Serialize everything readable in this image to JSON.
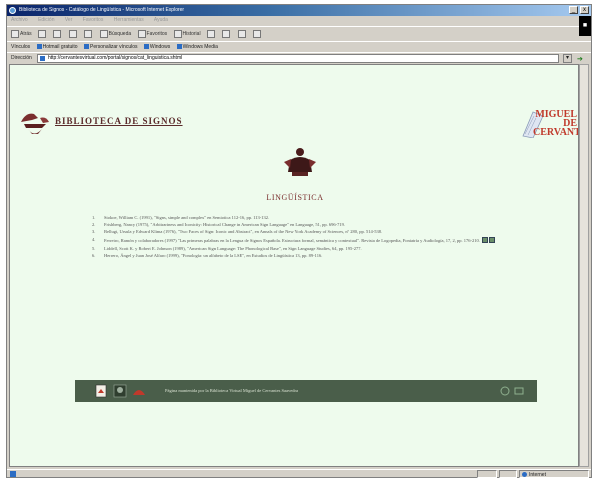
{
  "window": {
    "title": "Biblioteca de Signos - Catálogo de Lingüística - Microsoft Internet Explorer",
    "controls": [
      "_",
      "x"
    ]
  },
  "menu": [
    "Archivo",
    "Edición",
    "Ver",
    "Favoritos",
    "Herramientas",
    "Ayuda"
  ],
  "toolbar": {
    "back": "Atrás",
    "search": "Búsqueda",
    "favorites": "Favoritos",
    "history": "Historial"
  },
  "links": {
    "label": "Vínculos",
    "items": [
      "Hotmail gratuito",
      "Personalizar vínculos",
      "Windows",
      "Windows Media"
    ]
  },
  "address": {
    "label": "Dirección",
    "url": "http://cervantesvirtual.com/portal/signos/cat_linguistica.shtml"
  },
  "page": {
    "site_title": "BIBLIOTECA  DE  SIGNOS",
    "right_logo_text": "MIGUEL DE CERVANTES",
    "section_title": "LINGÜÍSTICA",
    "references": [
      {
        "num": "1.",
        "text": "Stokoe, William C. (1991), \"Signs, simple and complex\" en Semiotica 112-16, pp. 113-132."
      },
      {
        "num": "2.",
        "text": "Frishberg, Nancy (1975), \"Arbitrariness and Iconicity: Historical Change in American Sign Language\" en Language, 51, pp. 696-719."
      },
      {
        "num": "3.",
        "text": "Bellugi, Ursula y Edward Klima (1976), \"Two Faces of Sign: Iconic and Abstract\", en Annals of the New York Academy of Sciences, nº 280, pp. 514-538."
      },
      {
        "num": "4.",
        "text": "Ferreiro, Ramón y colaboradores (1997) \"Las primeras palabras en la Lengua de Signos Española. Estructura formal, semántica y contextual\". Revista de Logopedia, Foniatría y Audiología, 17, 2, pp. 176-210."
      },
      {
        "num": "5.",
        "text": "Liddell, Scott K. y Robert E. Johnson (1989), \"American Sign Language: The Phonological Base\", en Sign Language Studies, 64, pp. 195-277."
      },
      {
        "num": "6.",
        "text": "Herrero, Ángel y Juan José Alfaro (1999), \"Fonología: un alfabeto de la LSE\", en Estudios de Lingüística 13, pp. 89-116."
      }
    ],
    "footer_text": "Página mantenida por la Biblioteca Virtual Miguel de Cervantes Saavedra"
  },
  "status": {
    "zone": "Internet"
  },
  "colors": {
    "page_bg": "#eefbed",
    "footer_bg": "#4a5e4a",
    "title_maroon": "#5a2a2a",
    "accent_red": "#c0392b"
  }
}
